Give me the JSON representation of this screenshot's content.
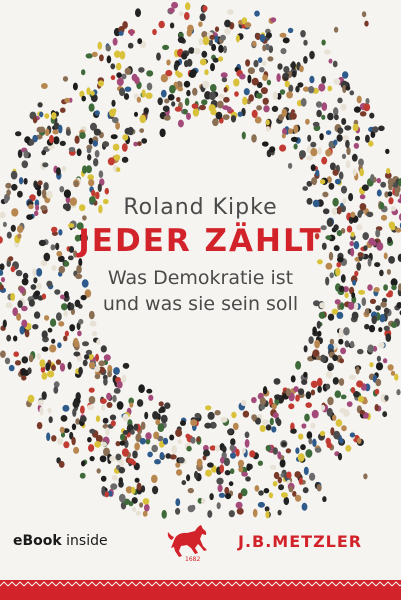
{
  "cover": {
    "author": "Roland Kipke",
    "title": "JEDER ZÄHLT",
    "subtitle_line1": "Was Demokratie ist",
    "subtitle_line2": "und was sie sein soll",
    "ebook_bold": "eBook",
    "ebook_rest": " inside",
    "logo_year": "1682",
    "publisher": "J.B.METZLER"
  },
  "colors": {
    "accent": "#d2232a",
    "background": "#f5f4f0",
    "text": "#4a4a4a"
  },
  "image": {
    "subject": "crowd of people forming a ring, viewed from above"
  }
}
